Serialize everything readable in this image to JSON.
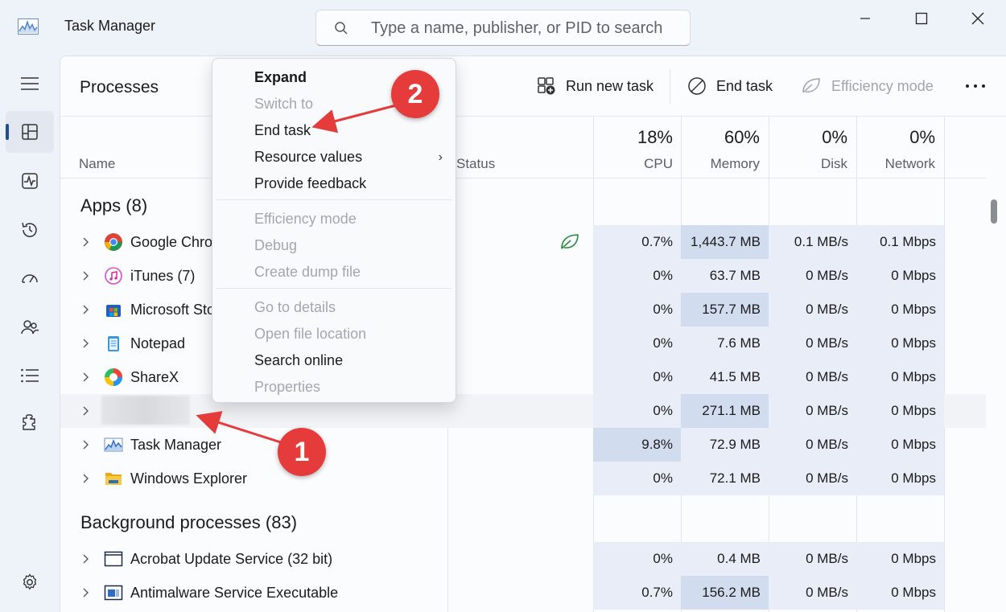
{
  "window": {
    "title": "Task Manager",
    "search_placeholder": "Type a name, publisher, or PID to search"
  },
  "main": {
    "title": "Processes",
    "toolbar": {
      "run_new_task": "Run new task",
      "end_task": "End task",
      "efficiency_mode": "Efficiency mode"
    }
  },
  "columns": {
    "name": "Name",
    "status": "Status",
    "cpu": {
      "pct": "18%",
      "label": "CPU"
    },
    "memory": {
      "pct": "60%",
      "label": "Memory"
    },
    "disk": {
      "pct": "0%",
      "label": "Disk"
    },
    "network": {
      "pct": "0%",
      "label": "Network"
    }
  },
  "apps": {
    "title": "Apps (8)",
    "rows": [
      {
        "name": "Google Chro",
        "icon": "chrome-icon",
        "cpu": "0.7%",
        "memory": "1,443.7 MB",
        "disk": "0.1 MB/s",
        "network": "0.1 Mbps"
      },
      {
        "name": "iTunes (7)",
        "icon": "itunes-icon",
        "cpu": "0%",
        "memory": "63.7 MB",
        "disk": "0 MB/s",
        "network": "0 Mbps"
      },
      {
        "name": "Microsoft Sto",
        "icon": "microsoft-store-icon",
        "cpu": "0%",
        "memory": "157.7 MB",
        "disk": "0 MB/s",
        "network": "0 Mbps"
      },
      {
        "name": "Notepad",
        "icon": "notepad-icon",
        "cpu": "0%",
        "memory": "7.6 MB",
        "disk": "0 MB/s",
        "network": "0 Mbps"
      },
      {
        "name": "ShareX",
        "icon": "sharex-icon",
        "cpu": "0%",
        "memory": "41.5 MB",
        "disk": "0 MB/s",
        "network": "0 Mbps"
      },
      {
        "name": "",
        "icon": "blurred-icon",
        "cpu": "0%",
        "memory": "271.1 MB",
        "disk": "0 MB/s",
        "network": "0 Mbps"
      },
      {
        "name": "Task Manager",
        "icon": "task-manager-icon",
        "cpu": "9.8%",
        "memory": "72.9 MB",
        "disk": "0 MB/s",
        "network": "0 Mbps"
      },
      {
        "name": "Windows Explorer",
        "icon": "folder-icon",
        "cpu": "0%",
        "memory": "72.1 MB",
        "disk": "0 MB/s",
        "network": "0 Mbps"
      }
    ]
  },
  "background": {
    "title": "Background processes (83)",
    "rows": [
      {
        "name": "Acrobat Update Service (32 bit)",
        "icon": "window-app-icon",
        "cpu": "0%",
        "memory": "0.4 MB",
        "disk": "0 MB/s",
        "network": "0 Mbps"
      },
      {
        "name": "Antimalware Service Executable",
        "icon": "defender-app-icon",
        "cpu": "0.7%",
        "memory": "156.2 MB",
        "disk": "0 MB/s",
        "network": "0 Mbps"
      }
    ]
  },
  "context_menu": {
    "items": [
      {
        "label": "Expand",
        "state": "bold"
      },
      {
        "label": "Switch to",
        "state": "disabled"
      },
      {
        "label": "End task",
        "state": "enabled"
      },
      {
        "label": "Resource values",
        "state": "submenu"
      },
      {
        "label": "Provide feedback",
        "state": "enabled"
      },
      {
        "label": "Efficiency mode",
        "state": "disabled"
      },
      {
        "label": "Debug",
        "state": "disabled"
      },
      {
        "label": "Create dump file",
        "state": "disabled"
      },
      {
        "label": "Go to details",
        "state": "disabled"
      },
      {
        "label": "Open file location",
        "state": "disabled"
      },
      {
        "label": "Search online",
        "state": "enabled"
      },
      {
        "label": "Properties",
        "state": "disabled"
      }
    ]
  },
  "annotations": {
    "badge1": "1",
    "badge2": "2"
  },
  "colors": {
    "heat_light": "#e8edf8",
    "heat_medium": "#d1dcef",
    "annotation_red": "#e63b3b",
    "accent": "#1b4f9c"
  }
}
